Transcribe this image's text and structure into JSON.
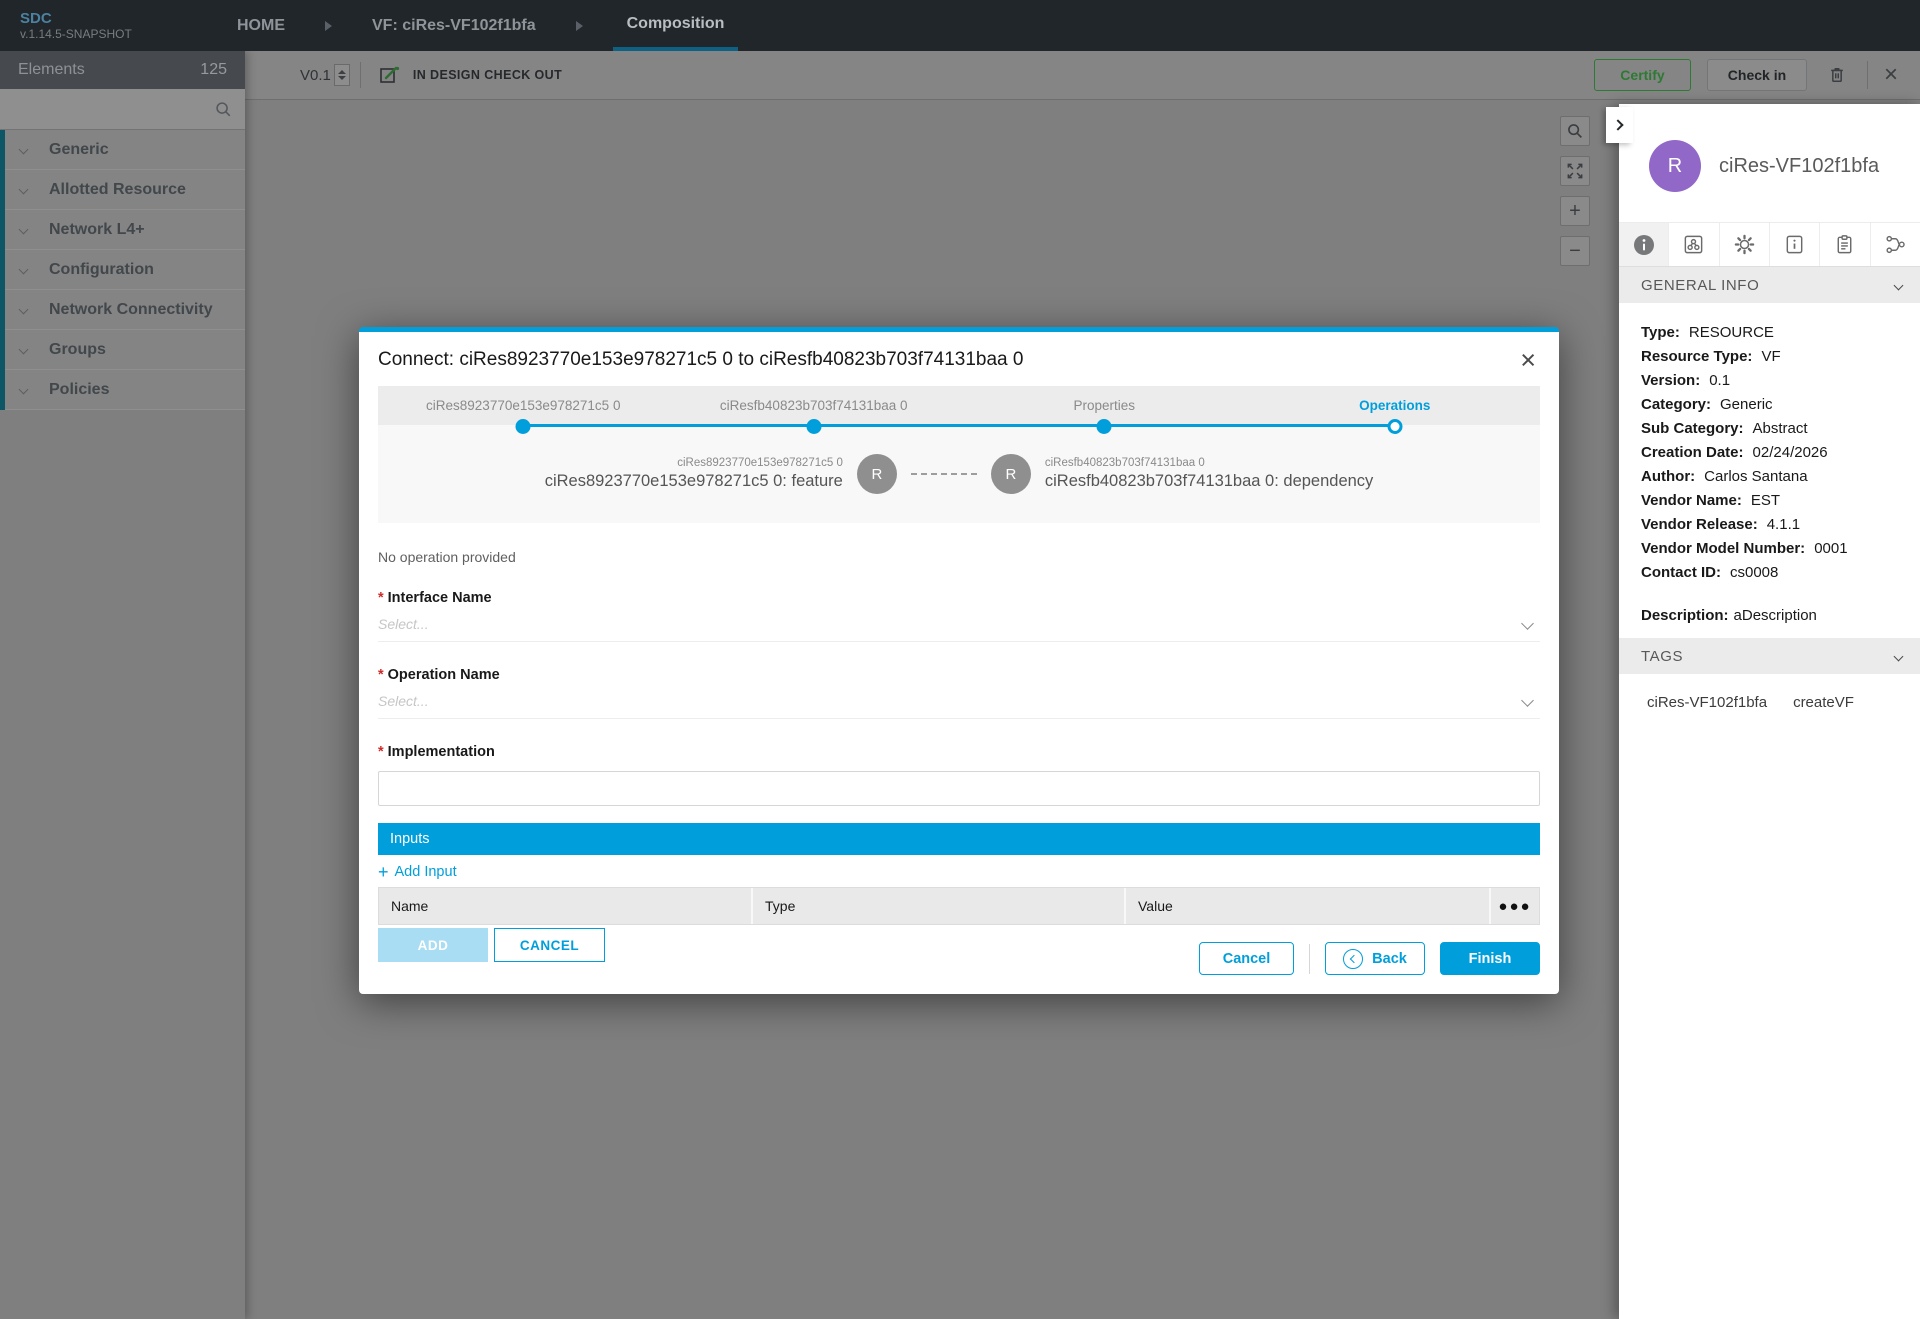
{
  "header": {
    "logo": "SDC",
    "version": "v.1.14.5-SNAPSHOT",
    "breadcrumbs": [
      {
        "label": "HOME"
      },
      {
        "label": "VF: ciRes-VF102f1bfa"
      },
      {
        "label": "Composition"
      }
    ]
  },
  "toolbar": {
    "version": "V0.1",
    "status": "IN DESIGN CHECK OUT",
    "certify_label": "Certify",
    "checkin_label": "Check in"
  },
  "sidebar": {
    "title": "Elements",
    "count": "125",
    "items": [
      {
        "label": "Generic"
      },
      {
        "label": "Allotted Resource"
      },
      {
        "label": "Network L4+"
      },
      {
        "label": "Configuration"
      },
      {
        "label": "Network Connectivity"
      },
      {
        "label": "Groups"
      },
      {
        "label": "Policies"
      }
    ]
  },
  "modal": {
    "title": "Connect: ciRes8923770e153e978271c5 0 to ciResfb40823b703f74131baa 0",
    "close_glyph": "×",
    "steps": [
      {
        "label": "ciRes8923770e153e978271c5 0"
      },
      {
        "label": "ciResfb40823b703f74131baa 0"
      },
      {
        "label": "Properties"
      },
      {
        "label": "Operations"
      }
    ],
    "preview": {
      "left_small": "ciRes8923770e153e978271c5 0",
      "left_big": "ciRes8923770e153e978271c5 0: feature",
      "right_small": "ciResfb40823b703f74131baa 0",
      "right_big": "ciResfb40823b703f74131baa 0: dependency",
      "node_letter": "R"
    },
    "no_operation": "No operation provided",
    "fields": {
      "required_mark": "*",
      "interface_label": "Interface Name",
      "operation_label": "Operation Name",
      "implementation_label": "Implementation",
      "select_placeholder": "Select..."
    },
    "inputs": {
      "header": "Inputs",
      "add_link": "Add Input",
      "add_plus": "+",
      "columns": [
        "Name",
        "Type",
        "Value"
      ],
      "dots": "●●●",
      "add_button": "ADD",
      "cancel_button": "CANCEL"
    },
    "footer": {
      "cancel": "Cancel",
      "back": "Back",
      "finish": "Finish"
    }
  },
  "right_panel": {
    "name": "ciRes-VF102f1bfa",
    "avatar_letter": "R",
    "general_info": {
      "title": "GENERAL INFO",
      "fields": [
        {
          "label": "Type:",
          "value": "RESOURCE"
        },
        {
          "label": "Resource Type:",
          "value": "VF"
        },
        {
          "label": "Version:",
          "value": "0.1"
        },
        {
          "label": "Category:",
          "value": "Generic"
        },
        {
          "label": "Sub Category:",
          "value": "Abstract"
        },
        {
          "label": "Creation Date:",
          "value": "02/24/2026"
        },
        {
          "label": "Author:",
          "value": "Carlos Santana"
        },
        {
          "label": "Vendor Name:",
          "value": "EST"
        },
        {
          "label": "Vendor Release:",
          "value": "4.1.1"
        },
        {
          "label": "Vendor Model Number:",
          "value": "0001"
        },
        {
          "label": "Contact ID:",
          "value": "cs0008"
        }
      ],
      "description_label": "Description:",
      "description_value": "aDescription"
    },
    "tags": {
      "title": "TAGS",
      "items": [
        "ciRes-VF102f1bfa",
        "createVF"
      ]
    }
  },
  "colors": {
    "accent_blue": "#009fdb",
    "certify_green": "#2e7a34",
    "avatar_purple": "#9168c7",
    "modal_backdrop": "#7f7f7f"
  }
}
